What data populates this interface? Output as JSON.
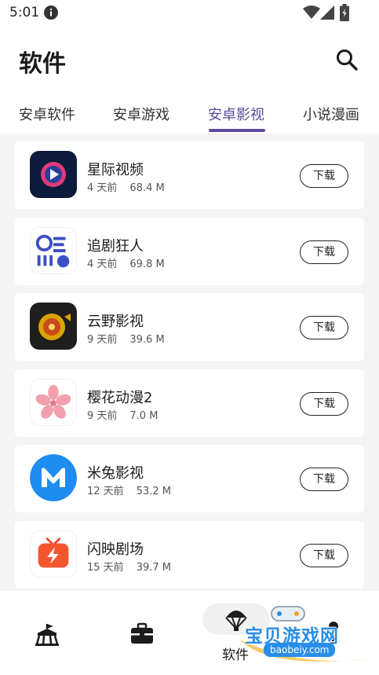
{
  "status_bar": {
    "time": "5:01"
  },
  "app_bar": {
    "title": "软件"
  },
  "tabs": [
    {
      "label": "安卓软件",
      "active": false
    },
    {
      "label": "安卓游戏",
      "active": false
    },
    {
      "label": "安卓影视",
      "active": true
    },
    {
      "label": "小说漫画",
      "active": false
    }
  ],
  "apps": [
    {
      "name": "星际视频",
      "age": "4 天前",
      "size": "68.4 M",
      "action": "下载",
      "icon": "play-icon"
    },
    {
      "name": "追剧狂人",
      "age": "4 天前",
      "size": "69.8 M",
      "action": "下载",
      "icon": "mascot-icon"
    },
    {
      "name": "云野影视",
      "age": "9 天前",
      "size": "39.6 M",
      "action": "下载",
      "icon": "film-reel-icon"
    },
    {
      "name": "樱花动漫2",
      "age": "9 天前",
      "size": "7.0 M",
      "action": "下载",
      "icon": "sakura-icon"
    },
    {
      "name": "米兔影视",
      "age": "12 天前",
      "size": "53.2 M",
      "action": "下载",
      "icon": "m-logo-icon"
    },
    {
      "name": "闪映剧场",
      "age": "15 天前",
      "size": "39.7 M",
      "action": "下载",
      "icon": "tv-flash-icon"
    }
  ],
  "bottom_nav": {
    "active_label": "软件"
  },
  "watermark": {
    "text": "宝贝游戏网",
    "url": "baobeiy.com"
  },
  "colors": {
    "accent": "#5e4b9c",
    "list_background": "#f4f4f4"
  }
}
